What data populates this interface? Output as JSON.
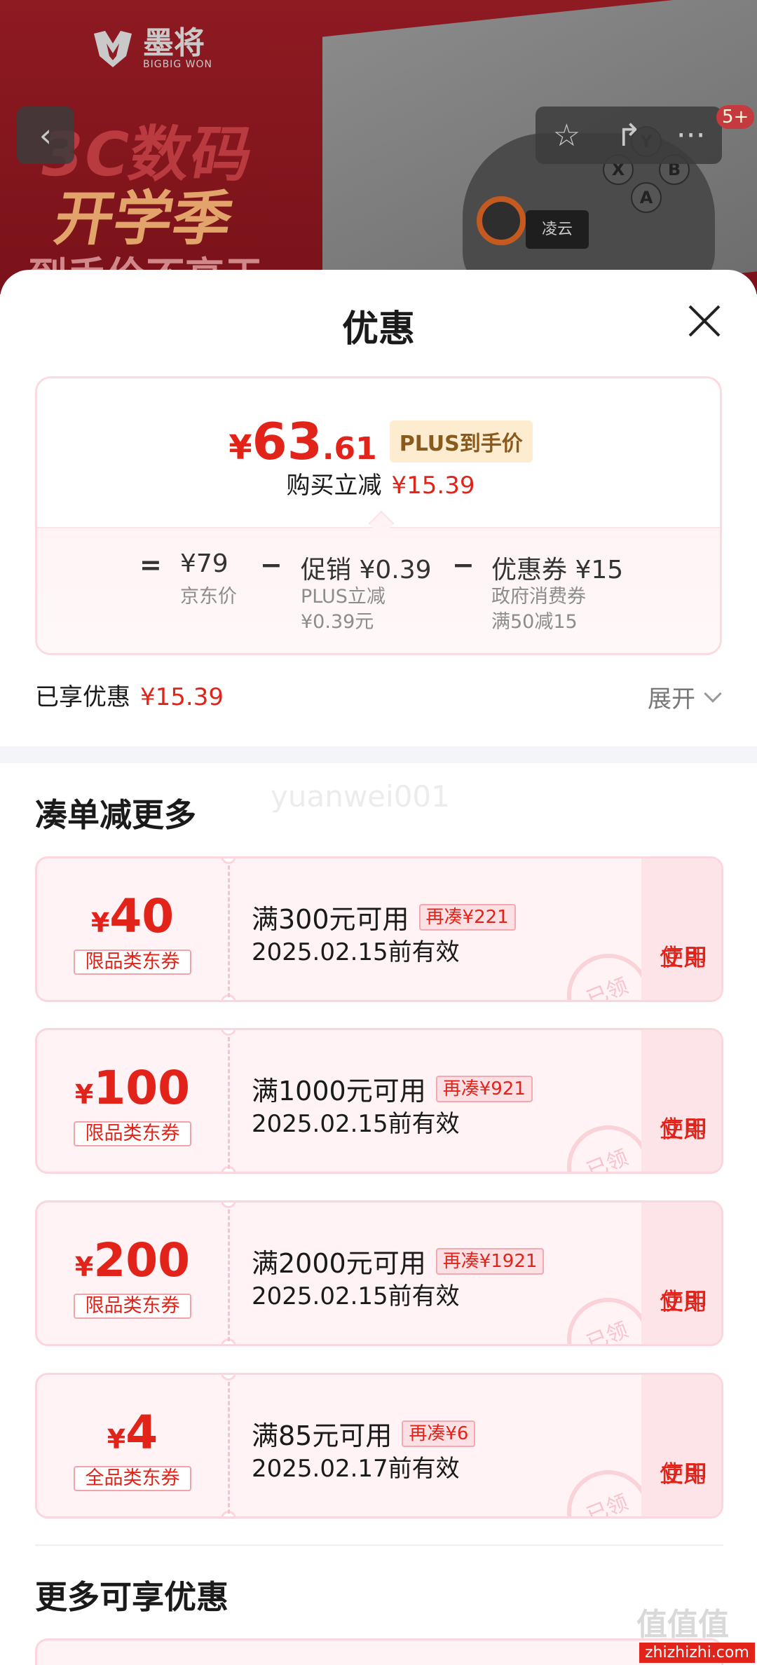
{
  "hero": {
    "brand_cn": "墨将",
    "brand_en": "BIGBIG WON",
    "promo_line1": "3C数码",
    "promo_line2": "开学季",
    "promo_line3": "到手价不高于",
    "device_screen": "凌云",
    "buttons": [
      "Y",
      "X",
      "B",
      "A"
    ],
    "badge": "5+"
  },
  "nav": {
    "back_glyph": "‹",
    "star_glyph": "☆",
    "share_glyph": "↱",
    "more_glyph": "···"
  },
  "sheet": {
    "title": "优惠"
  },
  "summary": {
    "currency": "¥",
    "price_int": "63",
    "price_dec": ".61",
    "plus_tag": "PLUS到手价",
    "reduce_label": "购买立减",
    "reduce_amount": "¥15.39",
    "breakdown": {
      "eq": "=",
      "jd_price": "¥79",
      "jd_label": "京东价",
      "minus1": "−",
      "promo": "促销 ¥0.39",
      "promo_sub1": "PLUS立减",
      "promo_sub2": "¥0.39元",
      "minus2": "−",
      "coupon": "优惠券 ¥15",
      "coupon_sub1": "政府消费券",
      "coupon_sub2": "满50减15"
    }
  },
  "enjoyed": {
    "label": "已享优惠",
    "amount": "¥15.39",
    "expand": "展开"
  },
  "section1_title": "凑单减更多",
  "watermark": "yuanwei001",
  "coupons": [
    {
      "cur": "¥",
      "amount": "40",
      "type": "限品类东券",
      "condition": "满300元可用",
      "extra": "再凑¥221",
      "valid": "2025.02.15前有效",
      "use_line1": "立即",
      "use_line2": "使用",
      "stamp": "已领"
    },
    {
      "cur": "¥",
      "amount": "100",
      "type": "限品类东券",
      "condition": "满1000元可用",
      "extra": "再凑¥921",
      "valid": "2025.02.15前有效",
      "use_line1": "立即",
      "use_line2": "使用",
      "stamp": "已领"
    },
    {
      "cur": "¥",
      "amount": "200",
      "type": "限品类东券",
      "condition": "满2000元可用",
      "extra": "再凑¥1921",
      "valid": "2025.02.15前有效",
      "use_line1": "立即",
      "use_line2": "使用",
      "stamp": "已领"
    },
    {
      "cur": "¥",
      "amount": "4",
      "type": "全品类东券",
      "condition": "满85元可用",
      "extra": "再凑¥6",
      "valid": "2025.02.17前有效",
      "use_line1": "立即",
      "use_line2": "使用",
      "stamp": "已领"
    }
  ],
  "section2_title": "更多可享优惠",
  "footer": {
    "site_mark": "值值值",
    "site_url": "zhizhizhi.com"
  }
}
